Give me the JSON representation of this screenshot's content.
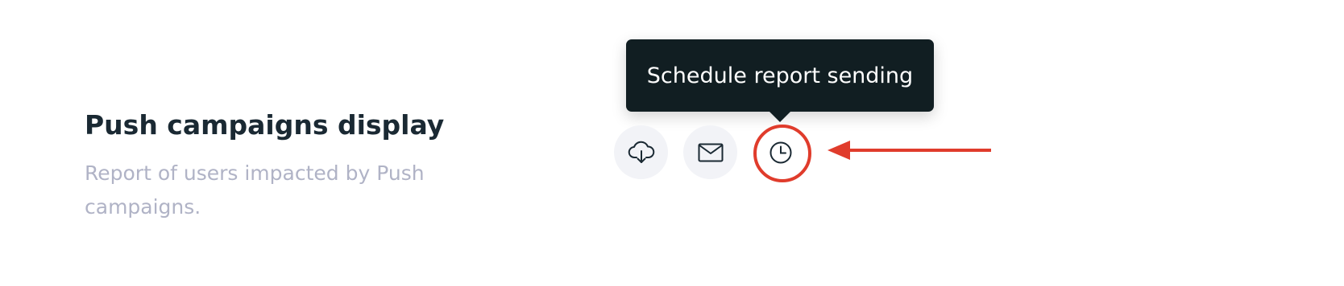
{
  "report": {
    "title": "Push campaigns display",
    "description": "Report of users impacted by Push campaigns."
  },
  "actions": [
    {
      "name": "download",
      "icon": "cloud-download-icon"
    },
    {
      "name": "email",
      "icon": "envelope-icon"
    },
    {
      "name": "schedule",
      "icon": "clock-icon"
    }
  ],
  "tooltip": {
    "text": "Schedule report sending"
  },
  "annotation": {
    "color": "#e03c2c"
  }
}
